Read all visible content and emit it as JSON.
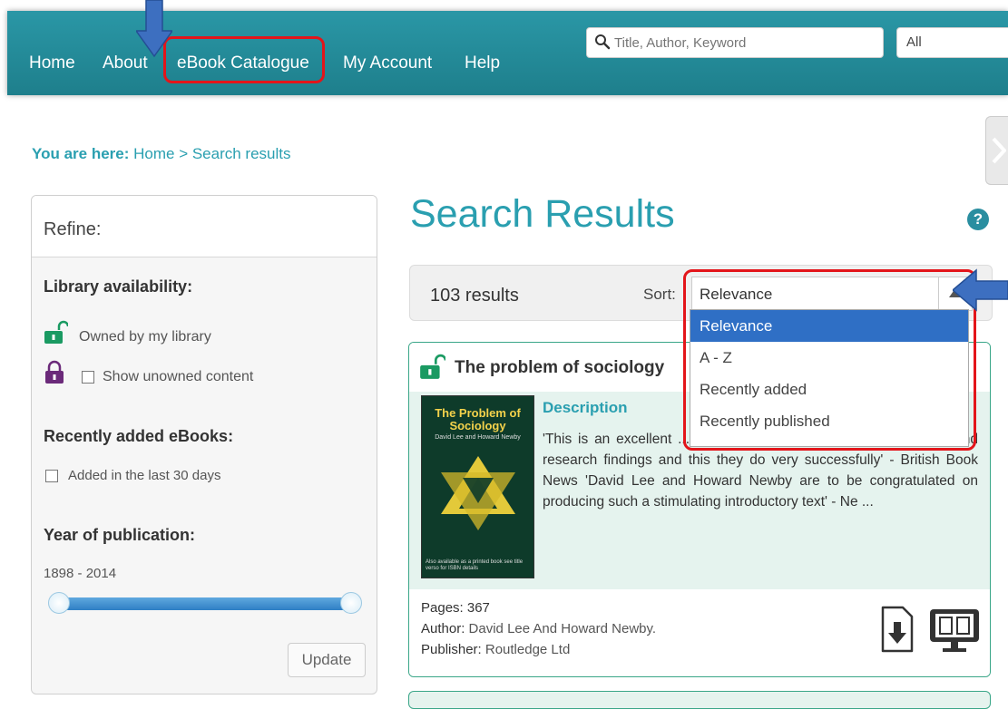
{
  "nav": {
    "items": [
      "Home",
      "About",
      "eBook Catalogue",
      "My Account",
      "Help"
    ],
    "search_placeholder": "Title, Author, Keyword",
    "scope": "All"
  },
  "breadcrumb": {
    "lead": "You are here:",
    "trail": "Home > Search results"
  },
  "refine": {
    "title": "Refine:",
    "availability_heading": "Library availability:",
    "owned_label": "Owned by my library",
    "unowned_label": "Show unowned content",
    "recent_heading": "Recently added eBooks:",
    "recent_label": "Added in the last 30 days",
    "year_heading": "Year of publication:",
    "year_range": "1898 - 2014",
    "update_label": "Update"
  },
  "main": {
    "title": "Search Results",
    "help_glyph": "?",
    "results_count": "103 results",
    "sort_label": "Sort:",
    "sort_selected": "Relevance",
    "sort_options": [
      "Relevance",
      "A - Z",
      "Recently added",
      "Recently published"
    ]
  },
  "result": {
    "title": "The problem of sociology",
    "cover_title": "The Problem of Sociology",
    "cover_author": "David Lee and Howard Newby",
    "cover_footer": "Also available as a printed book see title verso for ISBN details",
    "description_heading": "Description",
    "description": "'This is an excellent ... aim is to integrate theory, methodology and research findings and this they do very successfully' - British Book News 'David Lee and Howard Newby are to be congratulated on producing such a stimulating introductory text' - Ne ...",
    "pages_label": "Pages:",
    "pages": "367",
    "author_label": "Author:",
    "author": "David Lee And Howard Newby.",
    "publisher_label": "Publisher:",
    "publisher": "Routledge Ltd"
  },
  "colors": {
    "teal": "#2a9fb0",
    "nav_bg": "#2190a0",
    "annotation_red": "#e3151a",
    "annotation_arrow": "#3d6fc0",
    "selected_option": "#2f6fc5",
    "card_bg": "#e5f3ee"
  },
  "icons": {
    "search": "search-icon",
    "unlock": "unlock-icon",
    "lock": "lock-icon",
    "help": "help-icon",
    "download": "download-icon",
    "read_online": "read-online-icon"
  }
}
